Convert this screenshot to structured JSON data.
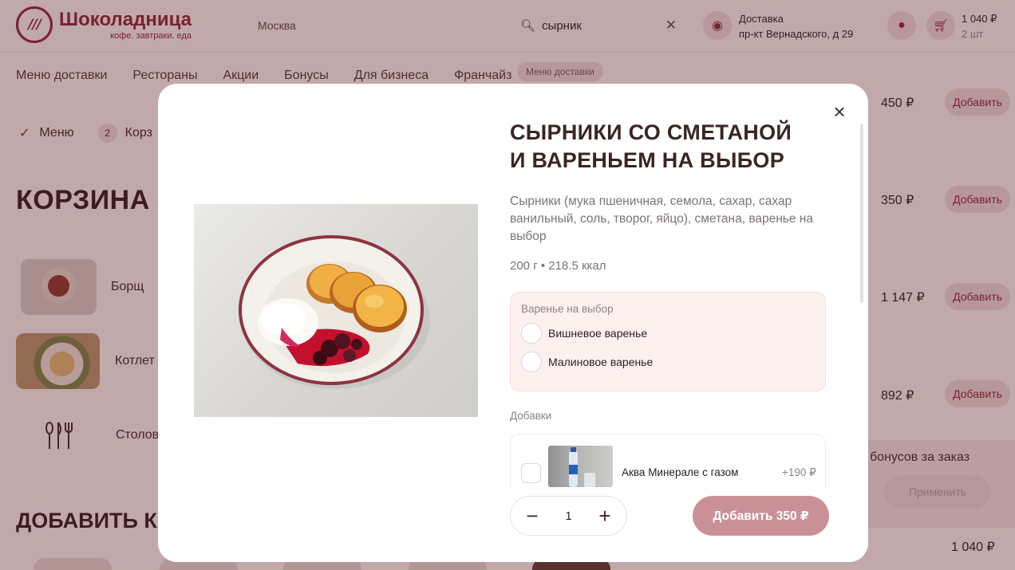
{
  "header": {
    "brand_name": "Шоколадница",
    "brand_tagline": "кофе. завтраки. еда",
    "city": "Москва",
    "search": {
      "value": "сырник"
    },
    "delivery": {
      "label": "Доставка",
      "address": "пр-кт Вернадского, д 29"
    },
    "cart": {
      "sum": "1 040 ₽",
      "count": "2 шт"
    }
  },
  "nav": {
    "items": [
      "Меню доставки",
      "Рестораны",
      "Акции",
      "Бонусы",
      "Для бизнеса",
      "Франчайз"
    ],
    "tooltip": "Меню доставки"
  },
  "breadcrumb": {
    "step1": "Меню",
    "step2_num": "2",
    "step2": "Корз"
  },
  "cart_page": {
    "title": "КОРЗИНА",
    "items": [
      {
        "name": "Борщ"
      },
      {
        "name": "Котлет"
      },
      {
        "name": "Столов"
      }
    ],
    "add_title": "ДОБАВИТЬ К З",
    "right_prices": [
      "450 ₽",
      "350 ₽",
      "1 147 ₽",
      "892 ₽"
    ],
    "add_label": "Добавить",
    "bonus_text": "бонусов за заказ",
    "apply_label": "Применить",
    "total": "1 040 ₽"
  },
  "modal": {
    "title": "СЫРНИКИ СО СМЕТАНОЙ И ВАРЕНЬЕМ НА ВЫБОР",
    "description": "Сырники (мука пшеничная, семола, сахар, сахар ванильный, соль, творог, яйцо), сметана, варенье на выбор",
    "weight": "200 г • 218.5 ккал",
    "jam": {
      "label": "Варенье на выбор",
      "options": [
        "Вишневое варенье",
        "Малиновое варенье"
      ]
    },
    "extras": {
      "label": "Добавки",
      "items": [
        {
          "name": "Аква Минерале с газом",
          "price": "+190 ₽"
        }
      ]
    },
    "quantity": "1",
    "add_button": "Добавить 350 ₽"
  },
  "colors": {
    "brand": "#8b2737",
    "overlay": "rgba(90,25,35,0.38)",
    "add_button": "#c99196",
    "jam_box": "#fdf1f0"
  },
  "icons": [
    "logo-icon",
    "search-icon",
    "clear-icon",
    "location-icon",
    "user-icon",
    "cart-icon",
    "check-icon",
    "cutlery-icon",
    "close-icon",
    "minus-icon",
    "plus-icon"
  ]
}
